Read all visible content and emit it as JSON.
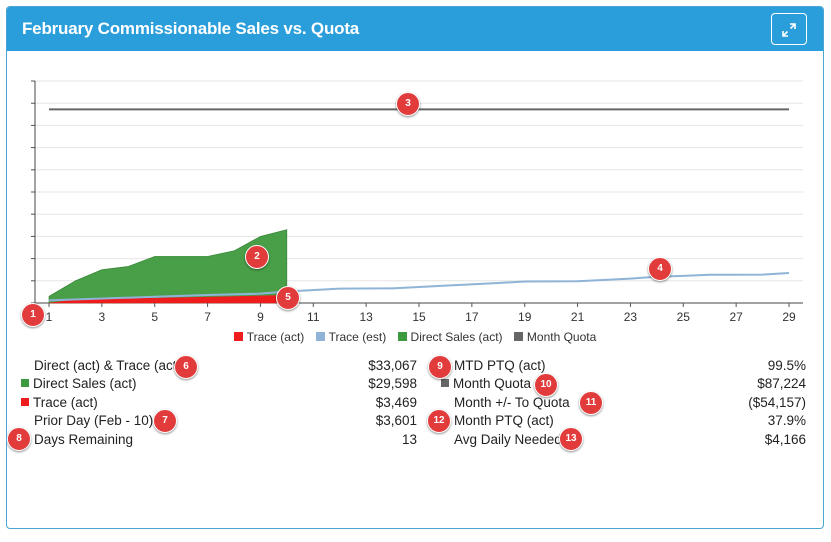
{
  "header": {
    "title": "February Commissionable Sales vs. Quota",
    "expand_icon": "expand-arrows-icon"
  },
  "colors": {
    "header_bg": "#2a9ddb",
    "trace_act": "#ee1c1c",
    "trace_est": "#8fb4d8",
    "direct_sales": "#3e9a3e",
    "month_quota": "#666666",
    "badge": "#e23b3b"
  },
  "chart_data": {
    "type": "area",
    "title": "",
    "x_ticks": [
      "1",
      "3",
      "5",
      "7",
      "9",
      "11",
      "13",
      "15",
      "17",
      "19",
      "21",
      "23",
      "25",
      "27",
      "29"
    ],
    "xlim": [
      1,
      29
    ],
    "ylim": [
      0,
      100000
    ],
    "y_gridlines": 10,
    "grid": true,
    "legend_position": "bottom-center",
    "series": [
      {
        "name": "Trace (act)",
        "kind": "area",
        "color": "#ee1c1c",
        "x": [
          1,
          2,
          3,
          4,
          5,
          6,
          7,
          8,
          9,
          10
        ],
        "y": [
          0,
          1400,
          1700,
          2000,
          2200,
          2400,
          2600,
          2900,
          3200,
          3469
        ]
      },
      {
        "name": "Trace (est)",
        "kind": "line",
        "color": "#8fb4d8",
        "x": [
          1,
          5,
          7,
          9,
          10,
          12,
          14,
          16,
          18,
          19,
          21,
          23,
          24,
          25,
          26,
          27,
          28,
          29
        ],
        "y": [
          1200,
          2800,
          3600,
          4200,
          5200,
          6500,
          6600,
          7800,
          9000,
          9700,
          9800,
          11000,
          11800,
          12200,
          12700,
          12700,
          12800,
          13500
        ]
      },
      {
        "name": "Direct Sales (act)",
        "kind": "area",
        "color": "#3e9a3e",
        "x": [
          1,
          2,
          3,
          4,
          5,
          6,
          7,
          8,
          9,
          10
        ],
        "y": [
          3000,
          10000,
          15000,
          16500,
          21000,
          21000,
          21000,
          23500,
          30000,
          33067
        ]
      },
      {
        "name": "Month Quota",
        "kind": "line",
        "color": "#666666",
        "x": [
          1,
          29
        ],
        "y": [
          87224,
          87224
        ]
      }
    ]
  },
  "legend": [
    {
      "label": "Trace (act)",
      "color": "#ee1c1c"
    },
    {
      "label": "Trace (est)",
      "color": "#8fb4d8"
    },
    {
      "label": "Direct Sales (act)",
      "color": "#3e9a3e"
    },
    {
      "label": "Month Quota",
      "color": "#666666"
    }
  ],
  "stats_left": [
    {
      "label": "Direct (act) & Trace (act)",
      "value": "$33,067",
      "swatch": ""
    },
    {
      "label": "Direct Sales (act)",
      "value": "$29,598",
      "swatch": "#3e9a3e"
    },
    {
      "label": "Trace (act)",
      "value": "$3,469",
      "swatch": "#ee1c1c"
    },
    {
      "label": "Prior Day (Feb - 10)",
      "value": "$3,601",
      "swatch": ""
    },
    {
      "label": "Days Remaining",
      "value": "13",
      "swatch": ""
    }
  ],
  "stats_right": [
    {
      "label": "MTD PTQ (act)",
      "value": "99.5%",
      "swatch": ""
    },
    {
      "label": "Month Quota",
      "value": "$87,224",
      "swatch": "#666666"
    },
    {
      "label": "Month +/- To Quota",
      "value": "($54,157)",
      "swatch": ""
    },
    {
      "label": "Month PTQ (act)",
      "value": "37.9%",
      "swatch": ""
    },
    {
      "label": "Avg Daily Needed",
      "value": "$4,166",
      "swatch": ""
    }
  ],
  "badges": [
    "1",
    "2",
    "3",
    "4",
    "5",
    "6",
    "7",
    "8",
    "9",
    "10",
    "11",
    "12",
    "13"
  ]
}
